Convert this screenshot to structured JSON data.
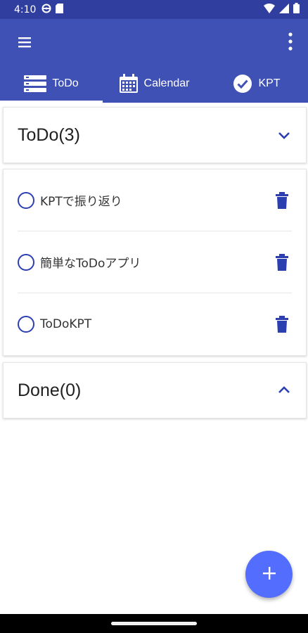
{
  "status_bar": {
    "time": "4:10",
    "icons": [
      "steering-wheel-icon",
      "sd-card-icon",
      "wifi-icon",
      "signal-icon",
      "battery-icon"
    ]
  },
  "app_bar": {
    "menu_icon": "hamburger-menu-icon",
    "overflow_icon": "more-vert-icon",
    "color": "#3f51b5"
  },
  "tabs": [
    {
      "label": "ToDo",
      "icon": "list-icon",
      "active": true
    },
    {
      "label": "Calendar",
      "icon": "calendar-icon",
      "active": false
    },
    {
      "label": "KPT",
      "icon": "check-circle-icon",
      "active": false
    }
  ],
  "todo_section": {
    "title": "ToDo(3)",
    "expanded": true,
    "items": [
      {
        "text": "KPTで振り返り"
      },
      {
        "text": "簡単なToDoアプリ"
      },
      {
        "text": "ToDoKPT"
      }
    ]
  },
  "done_section": {
    "title": "Done(0)",
    "expanded": false
  },
  "fab": {
    "icon": "plus-icon",
    "color": "#536dfe"
  },
  "accent_color": "#2b3fb0"
}
